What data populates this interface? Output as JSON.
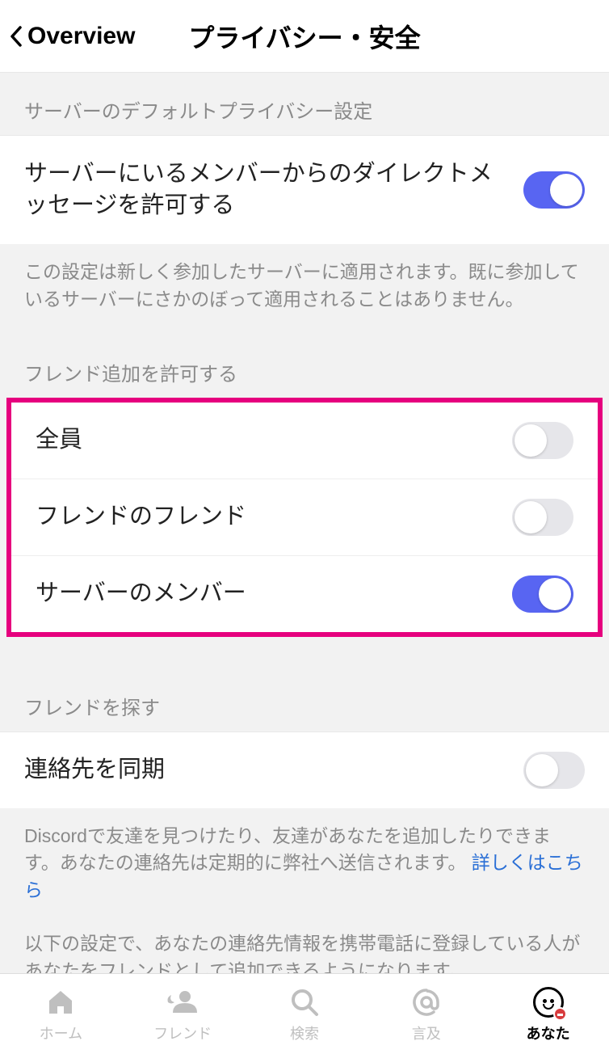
{
  "header": {
    "back_label": "Overview",
    "title": "プライバシー・安全"
  },
  "section1": {
    "header": "サーバーのデフォルトプライバシー設定",
    "row_label": "サーバーにいるメンバーからのダイレクトメッセージを許可する",
    "footer": "この設定は新しく参加したサーバーに適用されます。既に参加しているサーバーにさかのぼって適用されることはありません。"
  },
  "section2": {
    "header": "フレンド追加を許可する",
    "rows": [
      {
        "label": "全員",
        "on": false
      },
      {
        "label": "フレンドのフレンド",
        "on": false
      },
      {
        "label": "サーバーのメンバー",
        "on": true
      }
    ]
  },
  "section3": {
    "header": "フレンドを探す",
    "row_label": "連絡先を同期",
    "footer_pre": "Discordで友達を見つけたり、友達があなたを追加したりできます。あなたの連絡先は定期的に弊社へ送信されます。",
    "footer_link": "詳しくはこちら",
    "footer_extra": "以下の設定で、あなたの連絡先情報を携帯電話に登録している人があなたをフレンドとして追加できるようになります。"
  },
  "tabs": {
    "home": "ホーム",
    "friends": "フレンド",
    "search": "検索",
    "mentions": "言及",
    "you": "あなた"
  }
}
